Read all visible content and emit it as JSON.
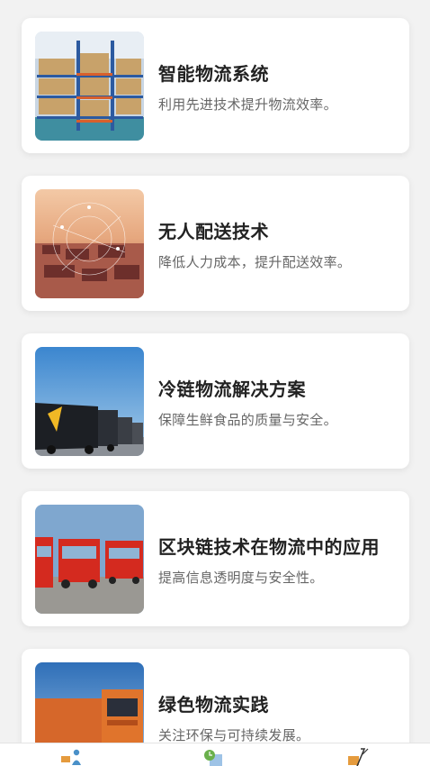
{
  "cards": [
    {
      "title": "智能物流系统",
      "desc": "利用先进技术提升物流效率。",
      "image": "warehouse-shelves-image"
    },
    {
      "title": "无人配送技术",
      "desc": "降低人力成本，提升配送效率。",
      "image": "port-network-image"
    },
    {
      "title": "冷链物流解决方案",
      "desc": "保障生鲜食品的质量与安全。",
      "image": "refrigerated-trucks-image"
    },
    {
      "title": "区块链技术在物流中的应用",
      "desc": "提高信息透明度与安全性。",
      "image": "red-trucks-image"
    },
    {
      "title": "绿色物流实践",
      "desc": "关注环保与可持续发展。",
      "image": "orange-truck-image"
    }
  ],
  "tabbar": {
    "items": [
      {
        "icon": "delivery-person-icon"
      },
      {
        "icon": "logistics-building-icon"
      },
      {
        "icon": "hand-truck-icon"
      }
    ]
  }
}
